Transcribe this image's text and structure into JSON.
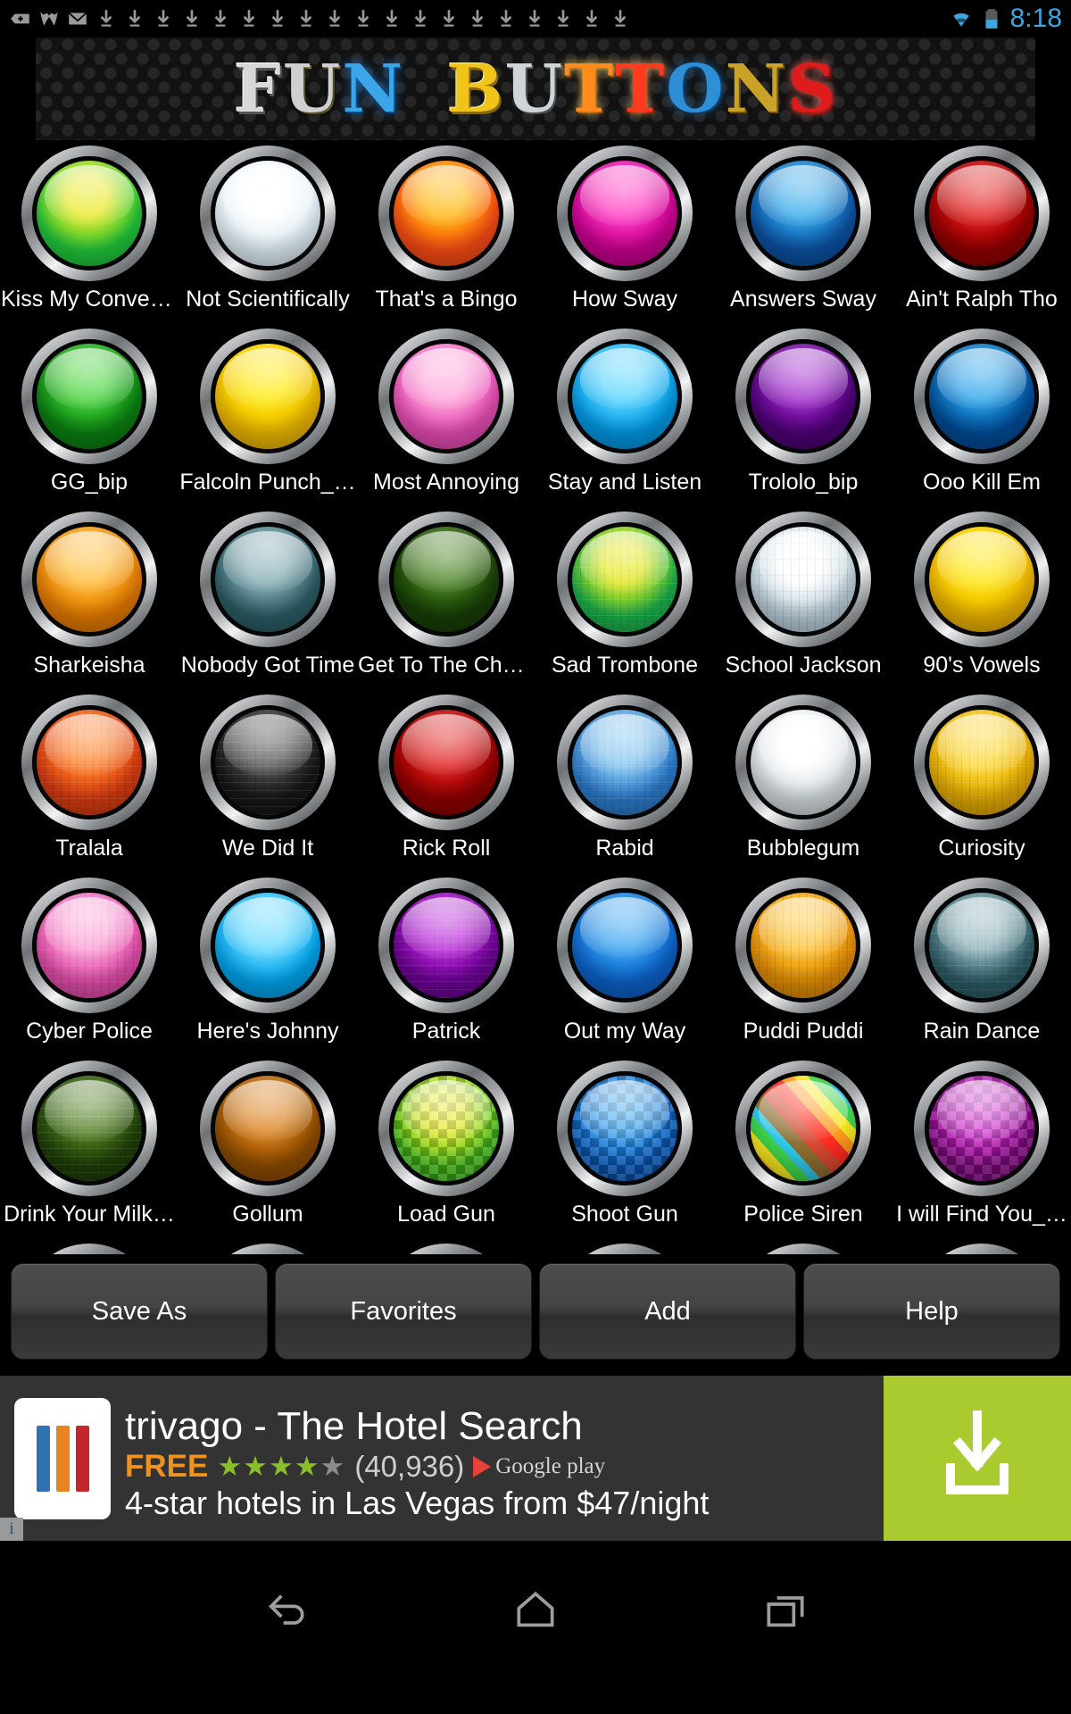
{
  "status_bar": {
    "icons": [
      "plus-badge-icon",
      "w-app-icon",
      "envelope-icon",
      "download-icon",
      "download-icon",
      "download-icon",
      "download-icon",
      "download-icon",
      "download-icon",
      "download-icon",
      "download-icon",
      "download-icon",
      "download-icon",
      "download-icon",
      "download-icon",
      "download-icon",
      "download-icon",
      "download-icon",
      "download-icon",
      "download-icon",
      "download-icon",
      "download-icon"
    ],
    "wifi_icon": "wifi-icon",
    "battery_icon": "battery-icon",
    "time": "8:18",
    "accent_color": "#3ba7e0"
  },
  "banner": {
    "title": "FUN BUTTONS",
    "letters": [
      {
        "ch": "F",
        "cls": "l1"
      },
      {
        "ch": "U",
        "cls": "l2"
      },
      {
        "ch": "N",
        "cls": "l3"
      },
      {
        "ch": "B",
        "cls": "l4"
      },
      {
        "ch": "U",
        "cls": "l5"
      },
      {
        "ch": "T",
        "cls": "l6"
      },
      {
        "ch": "T",
        "cls": "l7"
      },
      {
        "ch": "O",
        "cls": "l8"
      },
      {
        "ch": "N",
        "cls": "l9"
      },
      {
        "ch": "S",
        "cls": "l10"
      }
    ]
  },
  "grid": {
    "columns": 6,
    "buttons": [
      {
        "label": "Kiss My Conver…",
        "color": "#1fc43a",
        "color2": "#e8e81a",
        "texture": "none"
      },
      {
        "label": "Not Scientifically",
        "color": "#dceaf2",
        "color2": "#ffffff",
        "texture": "none"
      },
      {
        "label": "That's a Bingo",
        "color": "#f44a14",
        "color2": "#ffb300",
        "texture": "none"
      },
      {
        "label": "How Sway",
        "color": "#c3008c",
        "color2": "#ff2fbf",
        "texture": "none"
      },
      {
        "label": "Answers Sway",
        "color": "#0b4f9e",
        "color2": "#29a5e8",
        "texture": "none"
      },
      {
        "label": "Ain't Ralph Tho",
        "color": "#8c0000",
        "color2": "#e01010",
        "texture": "none"
      },
      {
        "label": "GG_bip",
        "color": "#0a7d10",
        "color2": "#3fd233",
        "texture": "none"
      },
      {
        "label": "Falcoln Punch_…",
        "color": "#e8b400",
        "color2": "#ffe700",
        "texture": "none"
      },
      {
        "label": "Most Annoying",
        "color": "#e04ab0",
        "color2": "#ff9fd8",
        "texture": "none"
      },
      {
        "label": "Stay and Listen",
        "color": "#0095e0",
        "color2": "#4fd3ff",
        "texture": "none"
      },
      {
        "label": "Trololo_bip",
        "color": "#4b0073",
        "color2": "#9b1fc9",
        "texture": "none"
      },
      {
        "label": "Ooo Kill Em",
        "color": "#004a94",
        "color2": "#1f9fe8",
        "texture": "none"
      },
      {
        "label": "Sharkeisha",
        "color": "#e07800",
        "color2": "#ffb82b",
        "texture": "none"
      },
      {
        "label": "Nobody Got Time",
        "color": "#2b5a63",
        "color2": "#7fa8b0",
        "texture": "none"
      },
      {
        "label": "Get To The  Cho…",
        "color": "#173c06",
        "color2": "#3f7a14",
        "texture": "none"
      },
      {
        "label": "Sad Trombone",
        "color": "#19b04a",
        "color2": "#e3e80f",
        "texture": "mosaic"
      },
      {
        "label": "School Jackson",
        "color": "#b8ccd8",
        "color2": "#ffffff",
        "texture": "mosaic"
      },
      {
        "label": "90's Vowels",
        "color": "#e8b000",
        "color2": "#ffe400",
        "texture": "none"
      },
      {
        "label": "Tralala",
        "color": "#d43a10",
        "color2": "#ff7a1f",
        "texture": "mosaic"
      },
      {
        "label": "We Did It",
        "color": "#161616",
        "color2": "#4a4a4a",
        "texture": "mosaic"
      },
      {
        "label": "Rick Roll",
        "color": "#8a0000",
        "color2": "#e01414",
        "texture": "none"
      },
      {
        "label": "Rabid",
        "color": "#2a79c9",
        "color2": "#7fc4f2",
        "texture": "mosaic"
      },
      {
        "label": "Bubblegum",
        "color": "#cfd6da",
        "color2": "#ffffff",
        "texture": "none"
      },
      {
        "label": "Curiosity",
        "color": "#e0a800",
        "color2": "#ffd82b",
        "texture": "mosaic"
      },
      {
        "label": "Cyber Police",
        "color": "#e04aa8",
        "color2": "#ff9fd6",
        "texture": "mosaic"
      },
      {
        "label": "Here's Johnny",
        "color": "#00a0e8",
        "color2": "#5fd8ff",
        "texture": "none"
      },
      {
        "label": "Patrick",
        "color": "#6b0094",
        "color2": "#b81fd8",
        "texture": "mosaic"
      },
      {
        "label": "Out my Way",
        "color": "#0b5fc4",
        "color2": "#2f9ff0",
        "texture": "none"
      },
      {
        "label": "Puddi Puddi",
        "color": "#e08a00",
        "color2": "#ffc12b",
        "texture": "mosaic"
      },
      {
        "label": "Rain Dance",
        "color": "#2b5a63",
        "color2": "#8fb4bc",
        "texture": "mosaic"
      },
      {
        "label": "Drink Your Milk…",
        "color": "#1e3d08",
        "color2": "#4a7a18",
        "texture": "mosaic"
      },
      {
        "label": "Gollum",
        "color": "#8a4a00",
        "color2": "#d97b14",
        "texture": "none"
      },
      {
        "label": "Load Gun",
        "color": "#4ac41f",
        "color2": "#e3e80f",
        "texture": "checker"
      },
      {
        "label": "Shoot Gun",
        "color": "#0b5fc4",
        "color2": "#2f9ff0",
        "texture": "checker"
      },
      {
        "label": "Police Siren",
        "color": "#e84a1f",
        "color2": "#f0d81f",
        "texture": "rainbow"
      },
      {
        "label": "I will Find You_…",
        "color": "#8a0b8a",
        "color2": "#d42fd4",
        "texture": "checker"
      },
      {
        "label": "",
        "color": "#1a1a2a",
        "color2": "#4a4a5a",
        "texture": "none"
      },
      {
        "label": "",
        "color": "#c40b0b",
        "color2": "#f03a3a",
        "texture": "checker"
      },
      {
        "label": "",
        "color": "#c40b9e",
        "color2": "#f03ad0",
        "texture": "checker"
      },
      {
        "label": "",
        "color": "#b06000",
        "color2": "#e08a10",
        "texture": "none"
      },
      {
        "label": "",
        "color": "#e8e8e8",
        "color2": "#ffffff",
        "texture": "none"
      },
      {
        "label": "",
        "color": "#d44ab0",
        "color2": "#ff8fd8",
        "texture": "checker"
      }
    ]
  },
  "action_bar": {
    "buttons": [
      {
        "label": "Save As",
        "name": "save-as-button"
      },
      {
        "label": "Favorites",
        "name": "favorites-button"
      },
      {
        "label": "Add",
        "name": "add-button"
      },
      {
        "label": "Help",
        "name": "help-button"
      }
    ]
  },
  "ad": {
    "title": "trivago - The Hotel Search",
    "price_label": "FREE",
    "stars_filled": 4,
    "stars_total": 5,
    "rating_count": "(40,936)",
    "store": "Google play",
    "subtitle": "4-star hotels in Las Vegas from $47/night",
    "cta_icon": "download-to-tray-icon",
    "cta_color": "#aacb30",
    "info_badge": "i",
    "icon_bar_colors": [
      "#2e74b5",
      "#e8851e",
      "#c4262e"
    ]
  },
  "nav_bar": {
    "items": [
      {
        "name": "nav-back-button",
        "icon": "back-arrow-icon"
      },
      {
        "name": "nav-home-button",
        "icon": "home-icon"
      },
      {
        "name": "nav-recents-button",
        "icon": "recents-icon"
      }
    ]
  }
}
